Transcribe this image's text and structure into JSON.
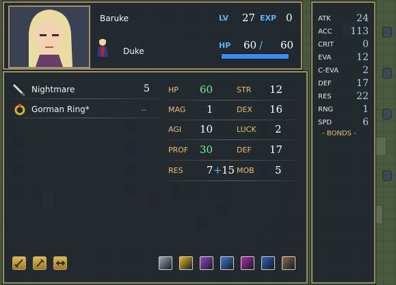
{
  "unit": {
    "name": "Baruke",
    "class": "Duke",
    "lv_label": "LV",
    "lv": "27",
    "exp_label": "EXP",
    "exp": "0",
    "hp_label": "HP",
    "hp_current": "60",
    "hp_sep": "/",
    "hp_max": "60",
    "hp_fraction": 1.0
  },
  "inventory": [
    {
      "name": "Nightmare",
      "uses": "5",
      "icon": "tome-icon"
    },
    {
      "name": "Gorman Ring*",
      "uses": "--",
      "icon": "ring-icon"
    }
  ],
  "stats": {
    "hp": {
      "label": "HP",
      "value": "60"
    },
    "str": {
      "label": "STR",
      "value": "12"
    },
    "mag": {
      "label": "MAG",
      "value": "1"
    },
    "dex": {
      "label": "DEX",
      "value": "16"
    },
    "agi": {
      "label": "AGI",
      "value": "10"
    },
    "luck": {
      "label": "LUCK",
      "value": "2"
    },
    "prof": {
      "label": "PROF",
      "value": "30"
    },
    "def": {
      "label": "DEF",
      "value": "17"
    },
    "res": {
      "label": "RES",
      "value": "7",
      "bonus_sign": "+",
      "bonus": "15"
    },
    "mob": {
      "label": "MOB",
      "value": "5"
    }
  },
  "combat": [
    {
      "label": "ATK",
      "value": "24"
    },
    {
      "label": "ACC",
      "value": "113"
    },
    {
      "label": "CRIT",
      "value": "0"
    },
    {
      "label": "EVA",
      "value": "12"
    },
    {
      "label": "C-EVA",
      "value": "2"
    },
    {
      "label": "DEF",
      "value": "17"
    },
    {
      "label": "RES",
      "value": "22"
    },
    {
      "label": "RNG",
      "value": "1"
    },
    {
      "label": "SPD",
      "value": "6"
    }
  ],
  "bonds_label": "- BONDS -",
  "weapon_ranks": [
    "sword-rank-icon",
    "axe-rank-icon",
    "lance-rank-icon"
  ],
  "skills": [
    {
      "icon": "chain-skill-icon",
      "color": "#9aa6b8"
    },
    {
      "icon": "gold-coin-skill-icon",
      "color": "#e6b820"
    },
    {
      "icon": "sword-skill-icon",
      "color": "#8a4ad0"
    },
    {
      "icon": "sparkle-skill-icon",
      "color": "#3c7ad8"
    },
    {
      "icon": "magic-skill-icon",
      "color": "#b02ab8"
    },
    {
      "icon": "heart-skill-icon",
      "color": "#2a62c8"
    },
    {
      "icon": "cross-swords-skill-icon",
      "color": "#8a6a4a"
    }
  ]
}
